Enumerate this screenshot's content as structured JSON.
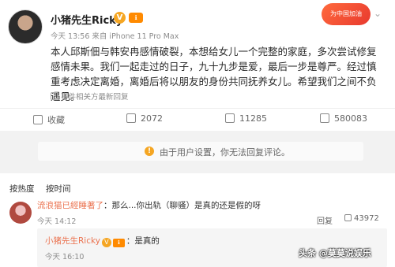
{
  "post": {
    "author": "小猪先生Ricky",
    "v_badge": "V",
    "level_badge": "ℹ",
    "promo_badge": "为中国加油",
    "meta": "今天 13:56 来自 iPhone 11 Pro Max",
    "content": "本人邱斯佃与韩安冉感情破裂，本想给女儿一个完整的家庭，多次尝试修复感情未果。我们一起走过的日子，九十九步是爱，最后一步是尊严。经过慎重考虑决定离婚，离婚后将以朋友的身份共同抚养女儿。希望我们之间不负遇见。",
    "edit_note": "事件相关方最新回复",
    "actions": {
      "favorite": "收藏",
      "repost": "2072",
      "comment": "11285",
      "like": "580083"
    }
  },
  "notice": {
    "text": "由于用户设置，你无法回复评论。"
  },
  "tabs": [
    "按热度",
    "按时间"
  ],
  "comment": {
    "name": "流浪猫已經睡著了",
    "body": "：那么...你出轨（聊骚）是真的还是假的呀",
    "time": "今天 14:12",
    "reply_label": "回复",
    "likes": "43972",
    "reply": {
      "name": "小猪先生Ricky",
      "body": "：是真的",
      "time": "今天 16:10"
    }
  },
  "watermark": "头条 @莫莫说娱乐"
}
